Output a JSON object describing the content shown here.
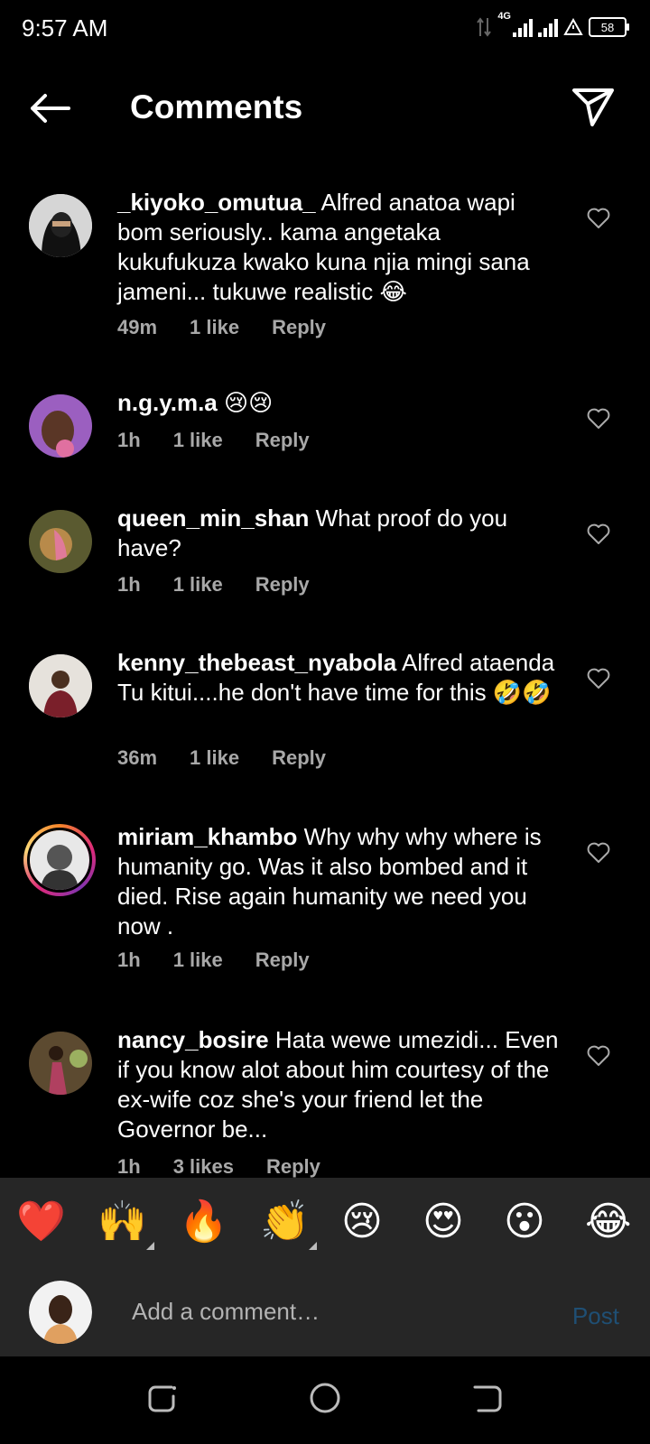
{
  "status": {
    "time": "9:57 AM",
    "network": "4G",
    "battery": "58"
  },
  "header": {
    "title": "Comments"
  },
  "comments": [
    {
      "username": "_kiyoko_omutua_",
      "text": "Alfred anatoa wapi bom seriously.. kama  angetaka kukufukuza kwako kuna njia mingi sana jameni... tukuwe realistic 😂",
      "time": "49m",
      "likes": "1 like",
      "reply": "Reply"
    },
    {
      "username": "n.g.y.m.a",
      "text": "😢😢",
      "time": "1h",
      "likes": "1 like",
      "reply": "Reply"
    },
    {
      "username": "queen_min_shan",
      "text": "What proof do you have?",
      "time": "1h",
      "likes": "1 like",
      "reply": "Reply"
    },
    {
      "username": "kenny_thebeast_nyabola",
      "text": "Alfred ataenda Tu kitui....he don't have time for this 🤣🤣",
      "time": "36m",
      "likes": "1 like",
      "reply": "Reply"
    },
    {
      "username": "miriam_khambo",
      "text": "Why why why where is humanity go. Was it also bombed and it died. Rise  again humanity we need you now .",
      "time": "1h",
      "likes": "1 like",
      "reply": "Reply"
    },
    {
      "username": "nancy_bosire",
      "text": "Hata wewe umezidi... Even if you know alot about him courtesy of the ex-wife coz she's your friend let the Governor be...",
      "time": "1h",
      "likes": "3 likes",
      "reply": "Reply"
    }
  ],
  "reactions": [
    "❤️",
    "🙌",
    "🔥",
    "👏",
    "😢",
    "😍",
    "😮",
    "😂"
  ],
  "composer": {
    "placeholder": "Add a comment…",
    "post_label": "Post"
  },
  "colors": {
    "background": "#000000",
    "bar": "#262626",
    "meta": "#a8a8a8",
    "post_disabled": "#1f4f74"
  }
}
